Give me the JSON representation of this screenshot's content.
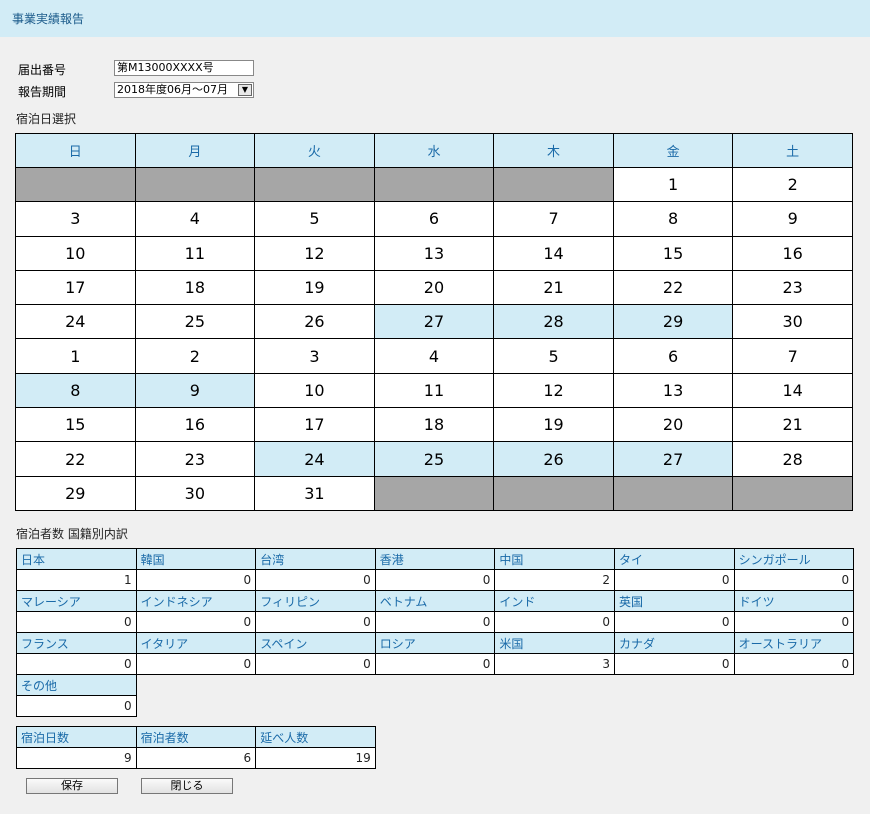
{
  "title": "事業実績報告",
  "form": {
    "notification_label": "届出番号",
    "notification_value": "第M13000XXXX号",
    "period_label": "報告期間",
    "period_value": "2018年度06月～07月"
  },
  "calendar": {
    "section_label": "宿泊日選択",
    "weekdays": [
      "日",
      "月",
      "火",
      "水",
      "木",
      "金",
      "土"
    ],
    "rows": [
      [
        {
          "d": "",
          "s": "blank"
        },
        {
          "d": "",
          "s": "blank"
        },
        {
          "d": "",
          "s": "blank"
        },
        {
          "d": "",
          "s": "blank"
        },
        {
          "d": "",
          "s": "blank"
        },
        {
          "d": "1",
          "s": ""
        },
        {
          "d": "2",
          "s": ""
        }
      ],
      [
        {
          "d": "3",
          "s": ""
        },
        {
          "d": "4",
          "s": ""
        },
        {
          "d": "5",
          "s": ""
        },
        {
          "d": "6",
          "s": ""
        },
        {
          "d": "7",
          "s": ""
        },
        {
          "d": "8",
          "s": ""
        },
        {
          "d": "9",
          "s": ""
        }
      ],
      [
        {
          "d": "10",
          "s": ""
        },
        {
          "d": "11",
          "s": ""
        },
        {
          "d": "12",
          "s": ""
        },
        {
          "d": "13",
          "s": ""
        },
        {
          "d": "14",
          "s": ""
        },
        {
          "d": "15",
          "s": ""
        },
        {
          "d": "16",
          "s": ""
        }
      ],
      [
        {
          "d": "17",
          "s": ""
        },
        {
          "d": "18",
          "s": ""
        },
        {
          "d": "19",
          "s": ""
        },
        {
          "d": "20",
          "s": ""
        },
        {
          "d": "21",
          "s": ""
        },
        {
          "d": "22",
          "s": ""
        },
        {
          "d": "23",
          "s": ""
        }
      ],
      [
        {
          "d": "24",
          "s": ""
        },
        {
          "d": "25",
          "s": ""
        },
        {
          "d": "26",
          "s": ""
        },
        {
          "d": "27",
          "s": "sel"
        },
        {
          "d": "28",
          "s": "sel"
        },
        {
          "d": "29",
          "s": "sel"
        },
        {
          "d": "30",
          "s": ""
        }
      ],
      [
        {
          "d": "1",
          "s": ""
        },
        {
          "d": "2",
          "s": ""
        },
        {
          "d": "3",
          "s": ""
        },
        {
          "d": "4",
          "s": ""
        },
        {
          "d": "5",
          "s": ""
        },
        {
          "d": "6",
          "s": ""
        },
        {
          "d": "7",
          "s": ""
        }
      ],
      [
        {
          "d": "8",
          "s": "sel"
        },
        {
          "d": "9",
          "s": "sel"
        },
        {
          "d": "10",
          "s": ""
        },
        {
          "d": "11",
          "s": ""
        },
        {
          "d": "12",
          "s": ""
        },
        {
          "d": "13",
          "s": ""
        },
        {
          "d": "14",
          "s": ""
        }
      ],
      [
        {
          "d": "15",
          "s": ""
        },
        {
          "d": "16",
          "s": ""
        },
        {
          "d": "17",
          "s": ""
        },
        {
          "d": "18",
          "s": ""
        },
        {
          "d": "19",
          "s": ""
        },
        {
          "d": "20",
          "s": ""
        },
        {
          "d": "21",
          "s": ""
        }
      ],
      [
        {
          "d": "22",
          "s": ""
        },
        {
          "d": "23",
          "s": ""
        },
        {
          "d": "24",
          "s": "sel"
        },
        {
          "d": "25",
          "s": "sel"
        },
        {
          "d": "26",
          "s": "sel"
        },
        {
          "d": "27",
          "s": "sel"
        },
        {
          "d": "28",
          "s": ""
        }
      ],
      [
        {
          "d": "29",
          "s": ""
        },
        {
          "d": "30",
          "s": ""
        },
        {
          "d": "31",
          "s": ""
        },
        {
          "d": "",
          "s": "blank"
        },
        {
          "d": "",
          "s": "blank"
        },
        {
          "d": "",
          "s": "blank"
        },
        {
          "d": "",
          "s": "blank"
        }
      ]
    ]
  },
  "countries": {
    "section_label": "宿泊者数 国籍別内訳",
    "items": [
      {
        "name": "日本",
        "value": "1"
      },
      {
        "name": "韓国",
        "value": "0"
      },
      {
        "name": "台湾",
        "value": "0"
      },
      {
        "name": "香港",
        "value": "0"
      },
      {
        "name": "中国",
        "value": "2"
      },
      {
        "name": "タイ",
        "value": "0"
      },
      {
        "name": "シンガポール",
        "value": "0"
      },
      {
        "name": "マレーシア",
        "value": "0"
      },
      {
        "name": "インドネシア",
        "value": "0"
      },
      {
        "name": "フィリピン",
        "value": "0"
      },
      {
        "name": "ベトナム",
        "value": "0"
      },
      {
        "name": "インド",
        "value": "0"
      },
      {
        "name": "英国",
        "value": "0"
      },
      {
        "name": "ドイツ",
        "value": "0"
      },
      {
        "name": "フランス",
        "value": "0"
      },
      {
        "name": "イタリア",
        "value": "0"
      },
      {
        "name": "スペイン",
        "value": "0"
      },
      {
        "name": "ロシア",
        "value": "0"
      },
      {
        "name": "米国",
        "value": "3"
      },
      {
        "name": "カナダ",
        "value": "0"
      },
      {
        "name": "オーストラリア",
        "value": "0"
      },
      {
        "name": "その他",
        "value": "0"
      }
    ]
  },
  "summary": [
    {
      "name": "宿泊日数",
      "value": "9"
    },
    {
      "name": "宿泊者数",
      "value": "6"
    },
    {
      "name": "延べ人数",
      "value": "19"
    }
  ],
  "buttons": {
    "save": "保存",
    "close": "閉じる"
  }
}
